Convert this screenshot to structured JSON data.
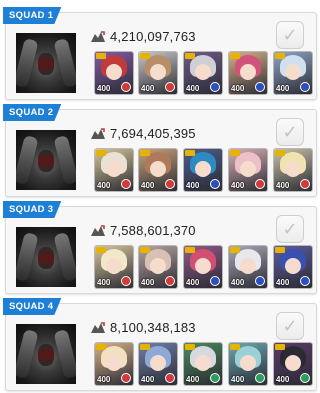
{
  "squads": [
    {
      "label": "SQUAD 1",
      "damage": "4,210,097,763",
      "units": [
        {
          "level": "400",
          "hair": "#c23b3b",
          "bg": "#7f5ca8",
          "elem": "#d23a3a"
        },
        {
          "level": "400",
          "hair": "#b88e68",
          "bg": "#c8c8c8",
          "elem": "#d23a3a"
        },
        {
          "level": "400",
          "hair": "#cfcfd8",
          "bg": "#6e5b8a",
          "elem": "#2a4fbf"
        },
        {
          "level": "400",
          "hair": "#d2537a",
          "bg": "#d9b08a",
          "elem": "#2a4fbf"
        },
        {
          "level": "400",
          "hair": "#cfe0f0",
          "bg": "#8ea4c8",
          "elem": "#2a4fbf"
        }
      ]
    },
    {
      "label": "SQUAD 2",
      "damage": "7,694,405,395",
      "units": [
        {
          "level": "400",
          "hair": "#e8e2d4",
          "bg": "#d6c49a",
          "elem": "#d23a3a"
        },
        {
          "level": "400",
          "hair": "#b07a5a",
          "bg": "#c7a47a",
          "elem": "#d23a3a"
        },
        {
          "level": "400",
          "hair": "#2e8bc2",
          "bg": "#4c5c8c",
          "elem": "#2a4fbf"
        },
        {
          "level": "400",
          "hair": "#ecc0c6",
          "bg": "#d9b0b4",
          "elem": "#d23a3a"
        },
        {
          "level": "400",
          "hair": "#f0e3b0",
          "bg": "#c8c2a8",
          "elem": "#d23a3a"
        }
      ]
    },
    {
      "label": "SQUAD 3",
      "damage": "7,588,601,370",
      "units": [
        {
          "level": "400",
          "hair": "#f2e8c8",
          "bg": "#d6c49a",
          "elem": "#d23a3a"
        },
        {
          "level": "400",
          "hair": "#d8c0b4",
          "bg": "#b7a4a0",
          "elem": "#d23a3a"
        },
        {
          "level": "400",
          "hair": "#d24f72",
          "bg": "#8e5a8a",
          "elem": "#2a4fbf"
        },
        {
          "level": "400",
          "hair": "#e8e8ec",
          "bg": "#a8a8b8",
          "elem": "#2a4fbf"
        },
        {
          "level": "400",
          "hair": "#3a4fb0",
          "bg": "#5c5c9c",
          "elem": "#2a4fbf"
        }
      ]
    },
    {
      "label": "SQUAD 4",
      "damage": "8,100,348,183",
      "units": [
        {
          "level": "400",
          "hair": "#f2e0c0",
          "bg": "#d6b08a",
          "elem": "#d23a3a"
        },
        {
          "level": "400",
          "hair": "#8ea8d8",
          "bg": "#6e7ea8",
          "elem": "#d23a3a"
        },
        {
          "level": "400",
          "hair": "#d8d8e0",
          "bg": "#4a8a5a",
          "elem": "#2aa05a"
        },
        {
          "level": "400",
          "hair": "#9ad0d6",
          "bg": "#6aa8b0",
          "elem": "#2aa05a"
        },
        {
          "level": "400",
          "hair": "#2a2a34",
          "bg": "#5a3a6a",
          "elem": "#2aa05a"
        }
      ]
    }
  ]
}
